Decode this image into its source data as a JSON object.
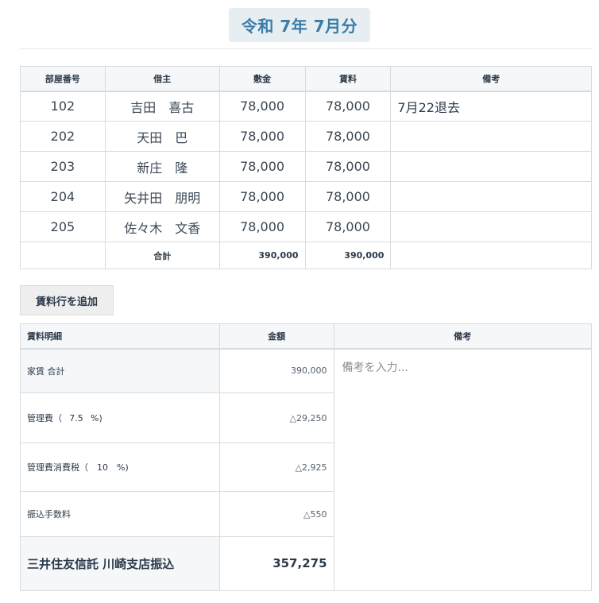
{
  "header": {
    "title": "令和 7年 7月分"
  },
  "rent_table": {
    "columns": [
      "部屋番号",
      "借主",
      "敷金",
      "賃料",
      "備考"
    ],
    "rows": [
      {
        "room": "102",
        "tenant": "吉田　喜古",
        "deposit": "78,000",
        "rent": "78,000",
        "note": "7月22退去"
      },
      {
        "room": "202",
        "tenant": "天田　巴",
        "deposit": "78,000",
        "rent": "78,000",
        "note": ""
      },
      {
        "room": "203",
        "tenant": "新庄　隆",
        "deposit": "78,000",
        "rent": "78,000",
        "note": ""
      },
      {
        "room": "204",
        "tenant": "矢井田　朋明",
        "deposit": "78,000",
        "rent": "78,000",
        "note": ""
      },
      {
        "room": "205",
        "tenant": "佐々木　文香",
        "deposit": "78,000",
        "rent": "78,000",
        "note": ""
      }
    ],
    "total": {
      "label": "合計",
      "deposit": "390,000",
      "rent": "390,000"
    }
  },
  "add_button": {
    "label": "賃料行を追加"
  },
  "detail_table": {
    "columns": [
      "賃料明細",
      "金額",
      "備考"
    ],
    "remarks_placeholder": "備考を入力...",
    "rows": {
      "rent_total": {
        "label": "家賃 合計",
        "amount": "390,000"
      },
      "mgmt_fee": {
        "label_pre": "管理費（",
        "pct": "7.5",
        "label_post": "%)",
        "amount": "△29,250"
      },
      "mgmt_tax": {
        "label_pre": "管理費消費税（",
        "pct": "10",
        "label_post": "%)",
        "amount": "△2,925"
      },
      "transfer_fee": {
        "label": "振込手数料",
        "amount": "△550"
      },
      "final": {
        "label": "三井住友信託 川崎支店振込",
        "amount": "357,275"
      }
    }
  }
}
